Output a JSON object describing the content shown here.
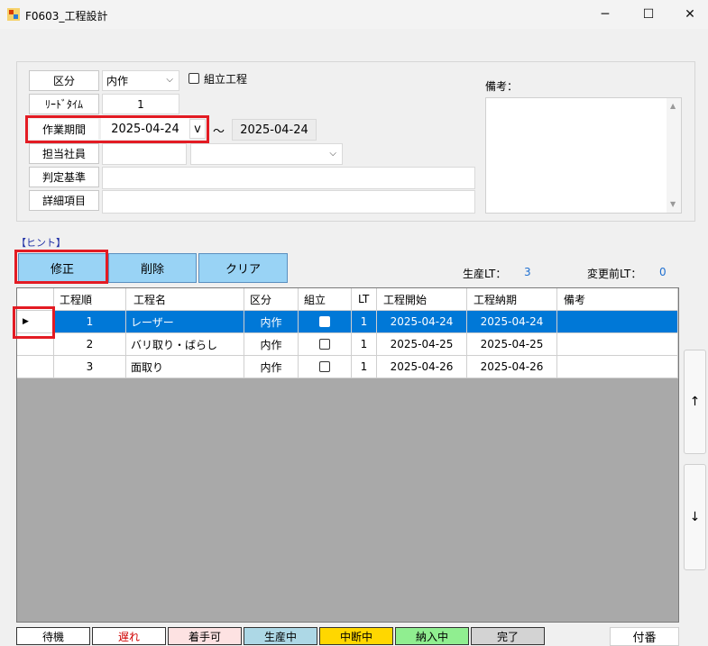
{
  "window": {
    "title": "F0603_工程設計",
    "minimize": "─",
    "maximize": "☐",
    "close": "✕"
  },
  "form": {
    "kubun_label": "区分",
    "kubun_value": "内作",
    "kumitate_label": "組立工程",
    "leadtime_label": "ﾘｰﾄﾞﾀｲﾑ",
    "leadtime_value": "1",
    "period_label": "作業期間",
    "period_start": "2025-04-24",
    "period_dropdown": "v",
    "period_sep": "～",
    "period_end": "2025-04-24",
    "staff_label": "担当社員",
    "staff_value": "",
    "criteria_label": "判定基準",
    "criteria_value": "",
    "detail_label": "詳細項目",
    "detail_value": "",
    "remarks_label": "備考："
  },
  "hint_label": "【ヒント】",
  "buttons": {
    "edit": "修正",
    "delete": "削除",
    "clear": "クリア"
  },
  "stats": {
    "prod_lt_label": "生産LT：",
    "prod_lt_value": "3",
    "before_lt_label": "変更前LT：",
    "before_lt_value": "0"
  },
  "grid": {
    "headers": [
      "工程順",
      "工程名",
      "区分",
      "組立",
      "LT",
      "工程開始",
      "工程納期",
      "備考"
    ],
    "rows": [
      {
        "order": "1",
        "name": "レーザー",
        "kubun": "内作",
        "lt": "1",
        "start": "2025-04-24",
        "due": "2025-04-24",
        "note": ""
      },
      {
        "order": "2",
        "name": "バリ取り・ばらし",
        "kubun": "内作",
        "lt": "1",
        "start": "2025-04-25",
        "due": "2025-04-25",
        "note": ""
      },
      {
        "order": "3",
        "name": "面取り",
        "kubun": "内作",
        "lt": "1",
        "start": "2025-04-26",
        "due": "2025-04-26",
        "note": ""
      }
    ],
    "selected_row": 0
  },
  "side_buttons": {
    "up": "↑",
    "down": "↓"
  },
  "legend": [
    {
      "label": "待機",
      "bg": "#ffffff",
      "color": "#000000"
    },
    {
      "label": "遅れ",
      "bg": "#ffffff",
      "color": "#d00000"
    },
    {
      "label": "着手可",
      "bg": "#fde2e2",
      "color": "#000000"
    },
    {
      "label": "生産中",
      "bg": "#add8e6",
      "color": "#000000"
    },
    {
      "label": "中断中",
      "bg": "#ffd700",
      "color": "#000000"
    },
    {
      "label": "納入中",
      "bg": "#90ee90",
      "color": "#000000"
    },
    {
      "label": "完了",
      "bg": "#d3d3d3",
      "color": "#000000"
    }
  ],
  "fuban_button": "付番",
  "colors": {
    "highlight": "#e31b23",
    "selection": "#0078d7",
    "button_blue": "#99d3f5",
    "stat_value": "#1e6fd0"
  }
}
